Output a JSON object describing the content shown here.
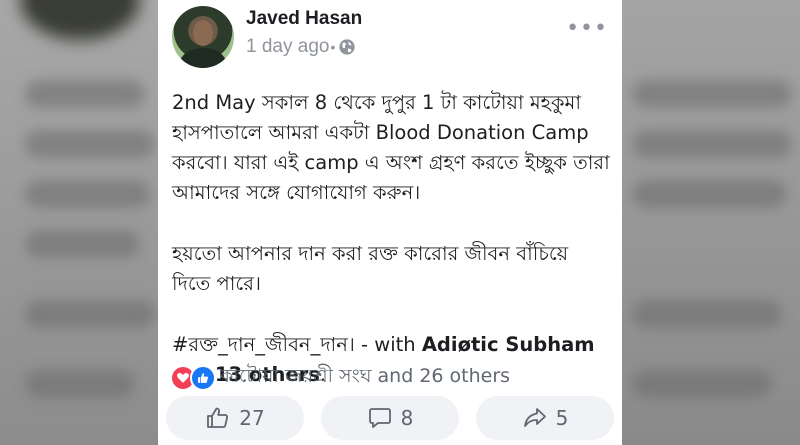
{
  "post": {
    "author": "Javed Hasan",
    "time": "1 day ago",
    "dot": "•",
    "more": "•••",
    "paragraph1": "2nd May সকাল 8 থেকে দুপুর 1 টা কাটোয়া মহকুমা হাসপাতালে আমরা একটা Blood Donation Camp করবো। যারা এই camp এ অংশ গ্রহণ করতে ইচ্ছুক তারা আমাদের সঙ্গে  যোগাযোগ করুন।",
    "paragraph2": "হয়তো আপনার দান করা রক্ত কারোর জীবন বাঁচিয়ে দিতে পারে।",
    "hashtag": "#রক্ত_দান_জীবন_দান।",
    "with_prefix": " - with ",
    "tagged_person": "Adiøtic Subham",
    "and_text": "and ",
    "others_text": "13 others",
    "period": "."
  },
  "reactions": {
    "summary": "কাটোয়া জয়শ্রী সংঘ and 26 others",
    "icons": [
      "love-icon",
      "like-icon"
    ]
  },
  "actions": {
    "like_count": "27",
    "comment_count": "8",
    "share_count": "5"
  },
  "colors": {
    "like_blue": "#1877f2",
    "love_red": "#f33e58",
    "button_bg": "#f0f2f5",
    "meta_gray": "#90949c"
  }
}
